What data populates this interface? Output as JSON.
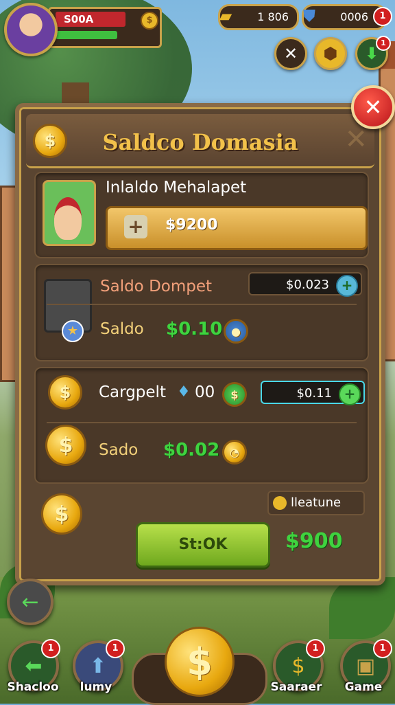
{
  "colors": {
    "gold": "#c9a24a",
    "title": "#f2c14a",
    "green": "#3fd33f",
    "close": "#d11f1f"
  },
  "hud": {
    "player_name": "S00A",
    "coin_glyph": "$",
    "gold_value": "1 806",
    "gem_value": "0006",
    "gem_badge": "1",
    "top_buttons": [
      "close-circle-icon",
      "dice-box-icon",
      "download-arrow-icon"
    ],
    "download_badge": "1"
  },
  "dialog": {
    "title": "Saldco Domasia",
    "close_glyph": "✕",
    "ghost_close_glyph": "✕",
    "wallet": {
      "label": "Inlaldo Mehalapet",
      "amount": "$9200",
      "plus": "+"
    },
    "section_saldo": {
      "label": "Saldo Dompet",
      "pill_value": "$0.023",
      "sub_label": "Saldo",
      "sub_value": "$0.10",
      "plus": "+"
    },
    "section_cargpelt": {
      "label": "Cargpelt",
      "gem_count": "00",
      "pill_value": "$0.11",
      "sub_label": "Sado",
      "sub_value": "$0.02",
      "plus": "+"
    },
    "feature_tag": "lleatune",
    "ok_label": "St:OK",
    "total": "$900"
  },
  "nav": {
    "back_glyph": "←",
    "items": [
      {
        "label": "Shacloo",
        "badge": "1",
        "icon": "green-arrow-icon"
      },
      {
        "label": "lumy",
        "badge": "1",
        "icon": "blue-arrow-icon"
      },
      {
        "label": "Saaraer",
        "badge": "1",
        "icon": "cash-coin-icon"
      },
      {
        "label": "Game",
        "badge": "1",
        "icon": "chest-icon"
      }
    ],
    "center_coin": "$"
  }
}
